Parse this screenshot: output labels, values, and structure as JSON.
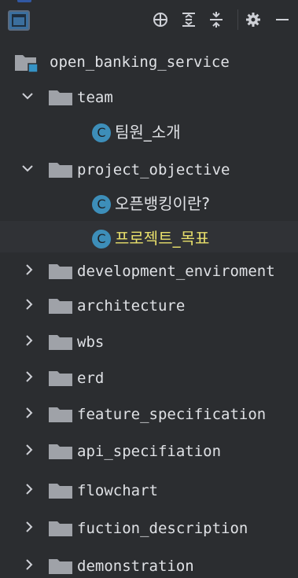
{
  "toolbar": {
    "icons": [
      "locate-icon",
      "expand-all-icon",
      "collapse-all-icon",
      "settings-icon",
      "hide-icon"
    ]
  },
  "tree": {
    "root": {
      "label": "open_banking_service",
      "icon": "module-icon"
    },
    "items": [
      {
        "label": "team",
        "kind": "folder",
        "expanded": true
      },
      {
        "label": "팀원_소개",
        "kind": "class",
        "badge": "C"
      },
      {
        "label": "project_objective",
        "kind": "folder",
        "expanded": true
      },
      {
        "label": "오픈뱅킹이란?",
        "kind": "class",
        "badge": "C"
      },
      {
        "label": "프로젝트_목표",
        "kind": "class",
        "badge": "C",
        "selected": true
      },
      {
        "label": "development_enviroment",
        "kind": "folder",
        "expanded": false
      },
      {
        "label": "architecture",
        "kind": "folder",
        "expanded": false
      },
      {
        "label": "wbs",
        "kind": "folder",
        "expanded": false
      },
      {
        "label": "erd",
        "kind": "folder",
        "expanded": false
      },
      {
        "label": "feature_specification",
        "kind": "folder",
        "expanded": false
      },
      {
        "label": "api_specifiation",
        "kind": "folder",
        "expanded": false
      },
      {
        "label": "flowchart",
        "kind": "folder",
        "expanded": false
      },
      {
        "label": "fuction_description",
        "kind": "folder",
        "expanded": false
      },
      {
        "label": "demonstration",
        "kind": "folder",
        "expanded": false
      }
    ]
  },
  "colors": {
    "background": "#2b2d30",
    "text": "#dfe1e5",
    "selected_text": "#e8df6b",
    "class_badge": "#3d8eb9",
    "folder": "#9fa2a8",
    "module_accent": "#3592c4"
  }
}
